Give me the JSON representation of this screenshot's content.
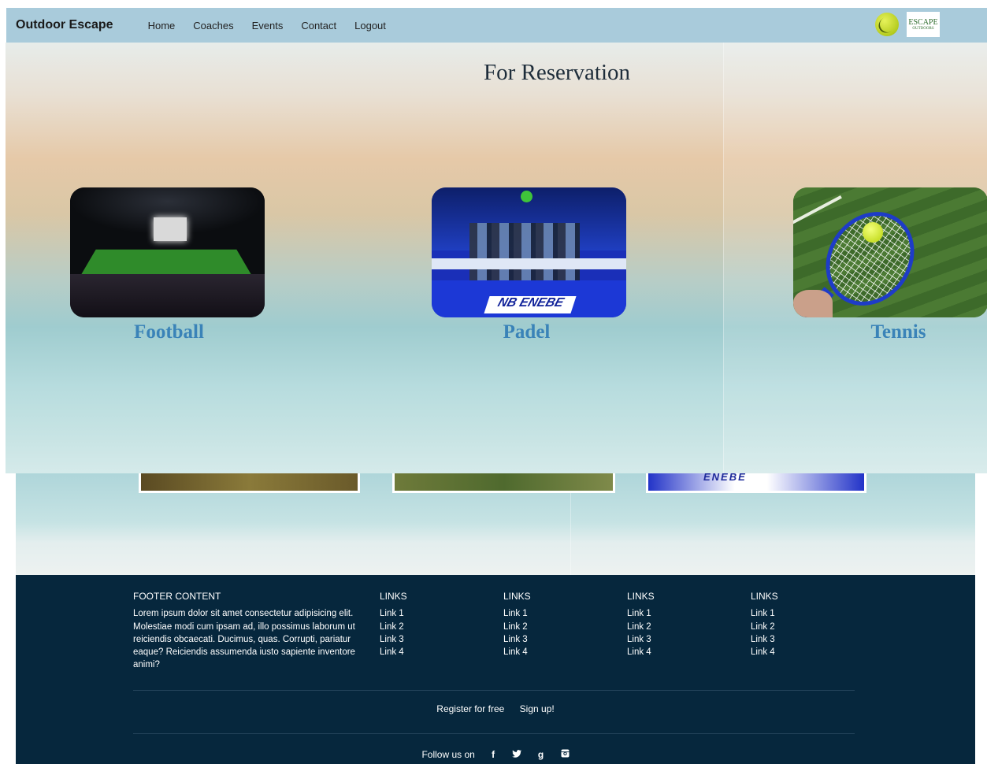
{
  "nav": {
    "brand": "Outdoor Escape",
    "links": [
      "Home",
      "Coaches",
      "Events",
      "Contact",
      "Logout"
    ],
    "logo_text": "ESCAPE",
    "logo_subtext": "OUTDOORS"
  },
  "hero": {
    "title": "For Reservation",
    "sports": [
      {
        "label": "Football"
      },
      {
        "label": "Padel"
      },
      {
        "label": "Tennis"
      }
    ],
    "padel_sign": "NB ENEBE"
  },
  "under": {
    "padel_sign": "ENEBE"
  },
  "footer": {
    "content_heading": "FOOTER CONTENT",
    "content_text": "Lorem ipsum dolor sit amet consectetur adipisicing elit. Molestiae modi cum ipsam ad, illo possimus laborum ut reiciendis obcaecati. Ducimus, quas. Corrupti, pariatur eaque? Reiciendis assumenda iusto sapiente inventore animi?",
    "link_columns": [
      {
        "heading": "LINKS",
        "links": [
          "Link 1",
          "Link 2",
          "Link 3",
          "Link 4"
        ]
      },
      {
        "heading": "LINKS",
        "links": [
          "Link 1",
          "Link 2",
          "Link 3",
          "Link 4"
        ]
      },
      {
        "heading": "LINKS",
        "links": [
          "Link 1",
          "Link 2",
          "Link 3",
          "Link 4"
        ]
      },
      {
        "heading": "LINKS",
        "links": [
          "Link 1",
          "Link 2",
          "Link 3",
          "Link 4"
        ]
      }
    ],
    "register_text": "Register for free",
    "signup_text": "Sign up!",
    "follow_text": "Follow us on",
    "social_icons": [
      "facebook-icon",
      "twitter-icon",
      "google-plus-icon",
      "instagram-icon"
    ]
  },
  "colors": {
    "nav_bg": "#a9cbdb",
    "footer_bg": "#06273d",
    "sport_label": "#3a83b8"
  }
}
